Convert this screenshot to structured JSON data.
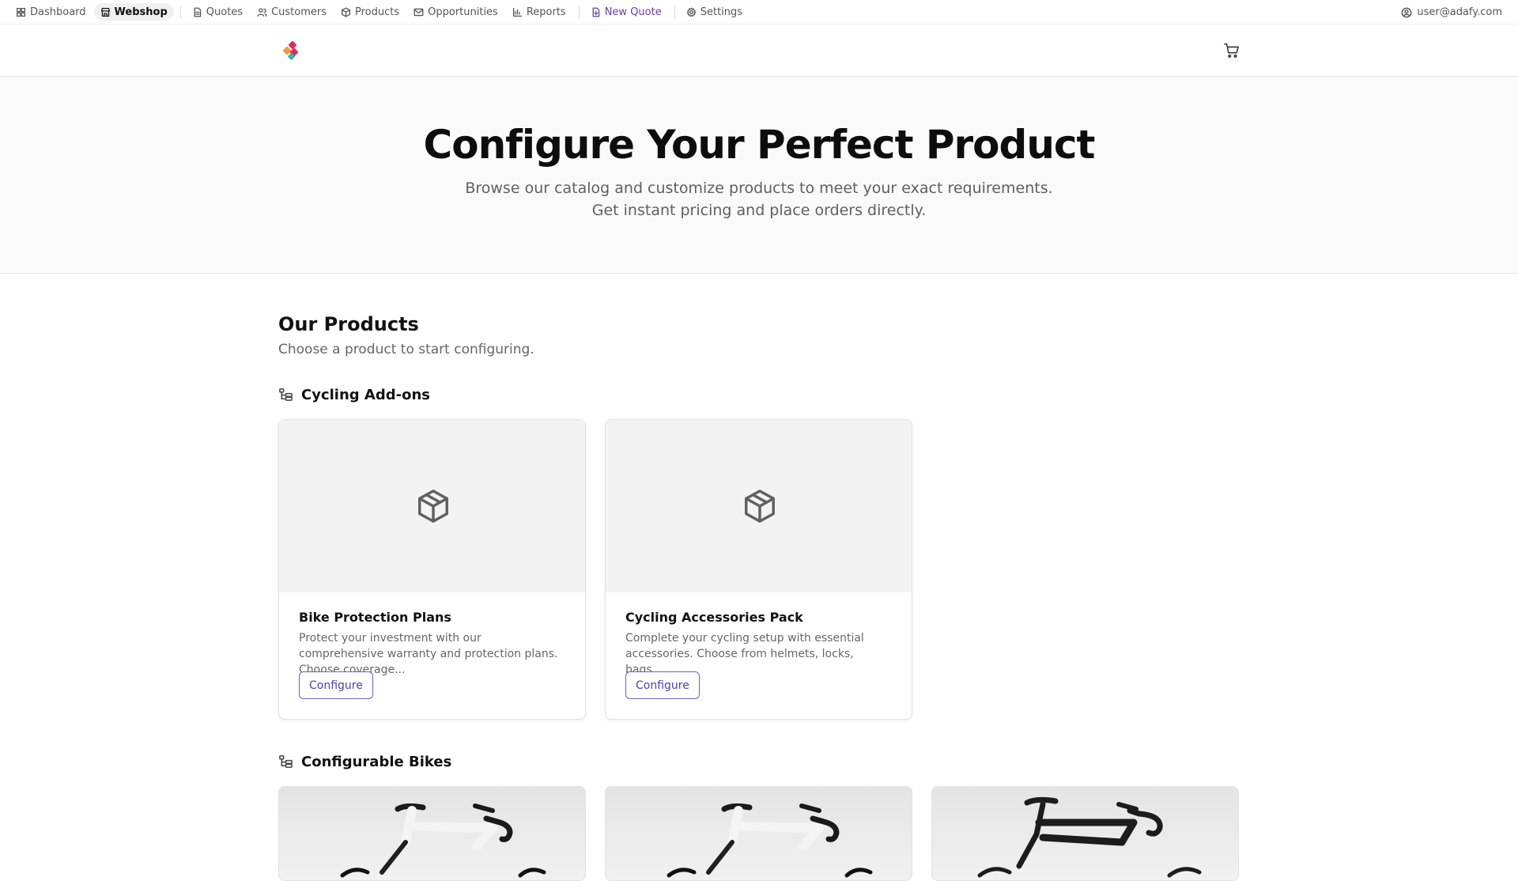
{
  "nav": {
    "items": [
      {
        "label": "Dashboard",
        "icon": "grid-icon"
      },
      {
        "label": "Webshop",
        "icon": "store-icon"
      },
      {
        "label": "Quotes",
        "icon": "document-icon"
      },
      {
        "label": "Customers",
        "icon": "users-icon"
      },
      {
        "label": "Products",
        "icon": "box-icon"
      },
      {
        "label": "Opportunities",
        "icon": "mail-icon"
      },
      {
        "label": "Reports",
        "icon": "bar-chart-icon"
      },
      {
        "label": "New Quote",
        "icon": "file-plus-icon"
      },
      {
        "label": "Settings",
        "icon": "gear-icon"
      }
    ],
    "active": "Webshop",
    "user": "user@adafy.com"
  },
  "hero": {
    "title": "Configure Your Perfect Product",
    "line1": "Browse our catalog and customize products to meet your exact requirements.",
    "line2": "Get instant pricing and place orders directly."
  },
  "products": {
    "title": "Our Products",
    "subtitle": "Choose a product to start configuring."
  },
  "categories": [
    {
      "name": "Cycling Add-ons",
      "items": [
        {
          "title": "Bike Protection Plans",
          "desc": "Protect your investment with our comprehensive warranty and protection plans. Choose coverage...",
          "button": "Configure"
        },
        {
          "title": "Cycling Accessories Pack",
          "desc": "Complete your cycling setup with essential accessories. Choose from helmets, locks, bags,...",
          "button": "Configure"
        }
      ]
    },
    {
      "name": "Configurable Bikes",
      "items": []
    }
  ],
  "colors": {
    "accent": "#6b3fa0",
    "button_border": "#6b63c4",
    "button_text": "#4b43a8"
  }
}
